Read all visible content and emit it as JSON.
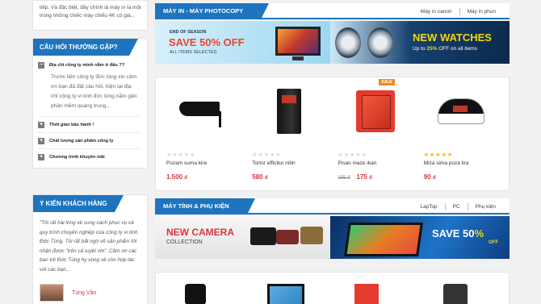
{
  "sidebar": {
    "intro_text": "tiếp. Và đặc biệt, đây chính là máy in là một trong những chiếc máy chiếu 4K có giá...",
    "faq": {
      "title": "CÂU HỎI THƯỜNG GẶP?",
      "items": [
        {
          "toggle": "−",
          "question": "Địa chỉ công ty mình nằm ở đâu ??",
          "answer": "Trước tiên công ty đức tùng xin cảm ơn bạn đã đặt câu hỏi, hiện tại địa chỉ công ty vi tính đức tùng nằm gần phần mềm quang trung..."
        },
        {
          "toggle": "+",
          "question": "Thời gian bảo hành !"
        },
        {
          "toggle": "+",
          "question": "Chất lượng sản phẩm công ty"
        },
        {
          "toggle": "+",
          "question": "Chương trình khuyến mãi"
        }
      ]
    },
    "testimonial": {
      "title": "Ý KIẾN KHÁCH HÀNG",
      "text": "\"Tôi rất hài lòng về cung cách phục vụ và quy trình chuyên nghiệp của công ty vi tính Đức Tùng. Tôi rất bất ngờ về sản phẩm tôi nhận được \"trên cả tuyệt vời\". Cảm ơn các bạn trẻ Đức Tùng hy vọng sẽ còn hợp tác với các bạn...",
      "user_name": "Tùng Văn"
    }
  },
  "section1": {
    "title": "MÁY IN - MÁY PHOTOCOPY",
    "links": [
      "Máy in canon",
      "Máy in phun"
    ],
    "banner_left": {
      "line1": "END OF SEASON",
      "line2": "SAVE 50% OFF",
      "line3": "ALL ITEMS SELECTED"
    },
    "banner_right": {
      "title": "NEW WATCHES",
      "sub_prefix": "Up to ",
      "sub_highlight": "25%",
      "sub_suffix": " OFF on all items"
    },
    "products": [
      {
        "name": "Pozam suma kire",
        "price": "1.500",
        "currency": "đ",
        "old_price": "",
        "rating": 0,
        "sale": ""
      },
      {
        "name": "Tortor efficitur nibh",
        "price": "580",
        "currency": "đ",
        "old_price": "",
        "rating": 0,
        "sale": ""
      },
      {
        "name": "Pisan maze ikan",
        "price": "175",
        "currency": "đ",
        "old_price": "155 đ",
        "rating": 0,
        "sale": "SALE"
      },
      {
        "name": "Miza sima poza lira",
        "price": "90",
        "currency": "đ",
        "old_price": "",
        "rating": 5,
        "sale": ""
      }
    ]
  },
  "section2": {
    "title": "MÁY TÍNH & PHỤ KIỆN",
    "links": [
      "LapTop",
      "PC",
      "Phụ kiện"
    ],
    "banner_left": {
      "line1": "NEW CAMERA",
      "line2": "COLLECTION"
    },
    "banner_right": {
      "save": "SAVE 50",
      "pct": "%",
      "off": "OFF"
    }
  },
  "icons": {
    "faq_toggle": "plus-minus-icon",
    "star": "star-icon"
  },
  "colors": {
    "accent": "#1e74bf",
    "price": "#d9363e",
    "sale": "#f08a24",
    "star": "#f5b21b"
  }
}
